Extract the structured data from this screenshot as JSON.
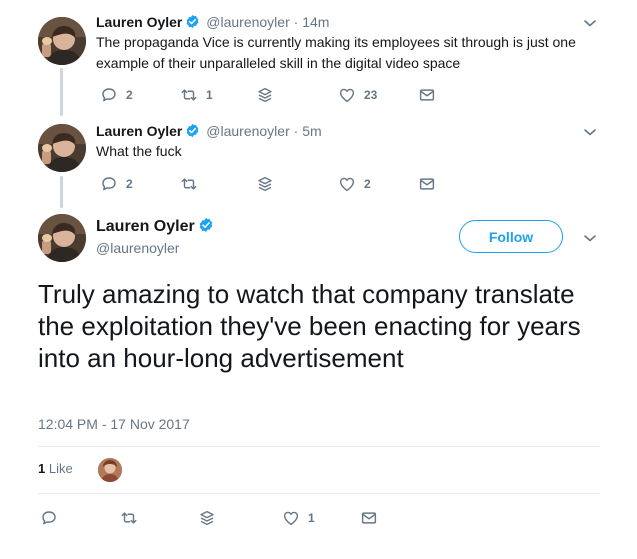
{
  "tweets": [
    {
      "name": "Lauren Oyler",
      "handle": "@laurenoyler",
      "time": "· 14m",
      "text": "The propaganda Vice is currently making its employees sit through is just one example of their unparalleled skill in the digital video space",
      "replies": "2",
      "retweets": "1",
      "likes": "23"
    },
    {
      "name": "Lauren Oyler",
      "handle": "@laurenoyler",
      "time": "· 5m",
      "text": "What the fuck",
      "replies": "2",
      "retweets": "",
      "likes": "2"
    }
  ],
  "main_tweet": {
    "name": "Lauren Oyler",
    "handle": "@laurenoyler",
    "follow_label": "Follow",
    "text": "Truly amazing to watch that company translate the exploitation they've been enacting for years into an hour-long advertisement",
    "datetime": "12:04 PM - 17 Nov 2017",
    "like_count": "1",
    "like_label": "Like",
    "likes": "1"
  },
  "colors": {
    "accent": "#1da1f2",
    "muted": "#657786",
    "divider": "#e6ecf0",
    "thread_line": "#ccd6dd"
  },
  "icons": [
    "verified-badge-icon",
    "chevron-down-icon",
    "reply-icon",
    "retweet-icon",
    "stack-icon",
    "heart-icon",
    "envelope-icon"
  ]
}
